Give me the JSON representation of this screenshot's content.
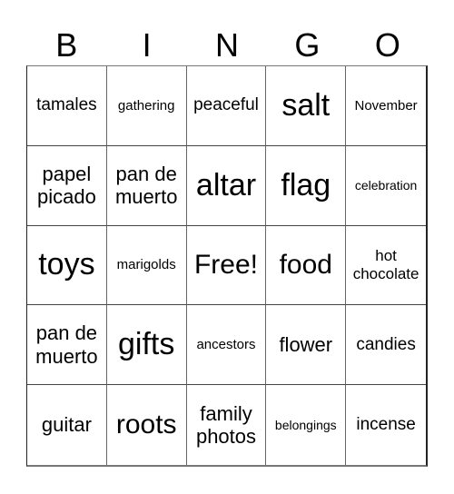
{
  "header": {
    "letters": [
      "B",
      "I",
      "N",
      "G",
      "O"
    ]
  },
  "cells": [
    {
      "text": "tamales",
      "size": "s-ms"
    },
    {
      "text": "gathering",
      "size": "s-xs"
    },
    {
      "text": "peaceful",
      "size": "s-ms"
    },
    {
      "text": "salt",
      "size": "s-xl"
    },
    {
      "text": "November",
      "size": "s-xs"
    },
    {
      "text": "papel picado",
      "size": "s-m"
    },
    {
      "text": "pan de muerto",
      "size": "s-m"
    },
    {
      "text": "altar",
      "size": "s-xl"
    },
    {
      "text": "flag",
      "size": "s-xl"
    },
    {
      "text": "celebration",
      "size": "s-xxs"
    },
    {
      "text": "toys",
      "size": "s-xl"
    },
    {
      "text": "marigolds",
      "size": "s-xs"
    },
    {
      "text": "Free!",
      "size": "s-l"
    },
    {
      "text": "food",
      "size": "s-l"
    },
    {
      "text": "hot chocolate",
      "size": "s-s"
    },
    {
      "text": "pan de muerto",
      "size": "s-m"
    },
    {
      "text": "gifts",
      "size": "s-xl"
    },
    {
      "text": "ancestors",
      "size": "s-xs"
    },
    {
      "text": "flower",
      "size": "s-m"
    },
    {
      "text": "candies",
      "size": "s-ms"
    },
    {
      "text": "guitar",
      "size": "s-m"
    },
    {
      "text": "roots",
      "size": "s-l"
    },
    {
      "text": "family photos",
      "size": "s-m"
    },
    {
      "text": "belongings",
      "size": "s-xxs"
    },
    {
      "text": "incense",
      "size": "s-ms"
    }
  ]
}
